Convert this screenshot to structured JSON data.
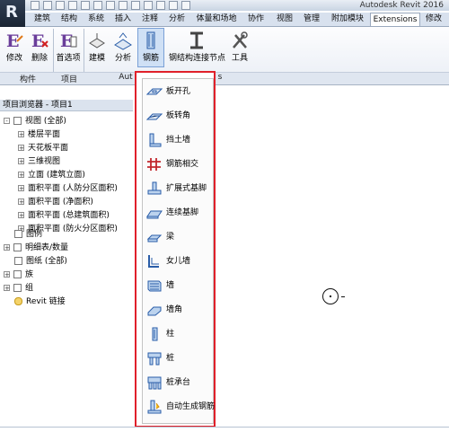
{
  "app": {
    "title": "Autodesk Revit 2016"
  },
  "tabs": [
    {
      "label": "建筑",
      "active": false
    },
    {
      "label": "结构",
      "active": false
    },
    {
      "label": "系统",
      "active": false
    },
    {
      "label": "插入",
      "active": false
    },
    {
      "label": "注释",
      "active": false
    },
    {
      "label": "分析",
      "active": false
    },
    {
      "label": "体量和场地",
      "active": false
    },
    {
      "label": "协作",
      "active": false
    },
    {
      "label": "视图",
      "active": false
    },
    {
      "label": "管理",
      "active": false
    },
    {
      "label": "附加模块",
      "active": false
    },
    {
      "label": "Extensions",
      "active": true
    },
    {
      "label": "修改",
      "active": false
    }
  ],
  "ribbon": {
    "buttons": {
      "modify": "修改",
      "delete": "删除",
      "preferences": "首选项",
      "model": "建模",
      "analysis": "分析",
      "rebar": "钢筋",
      "steel_connect": "钢结构连接节点",
      "tools": "工具"
    },
    "panels": {
      "component": "构件",
      "project": "项目",
      "auto_partial": "Aut",
      "tail": "s"
    }
  },
  "browser": {
    "title": "项目浏览器 - 项目1",
    "items": [
      {
        "label": "视图 (全部)",
        "level": 0,
        "toggle": "-"
      },
      {
        "label": "楼层平面",
        "level": 1,
        "toggle": "+"
      },
      {
        "label": "天花板平面",
        "level": 1,
        "toggle": "+"
      },
      {
        "label": "三维视图",
        "level": 1,
        "toggle": "+"
      },
      {
        "label": "立面 (建筑立面)",
        "level": 1,
        "toggle": "+"
      },
      {
        "label": "面积平面 (人防分区面积)",
        "level": 1,
        "toggle": "+"
      },
      {
        "label": "面积平面 (净面积)",
        "level": 1,
        "toggle": "+"
      },
      {
        "label": "面积平面 (总建筑面积)",
        "level": 1,
        "toggle": "+"
      },
      {
        "label": "面积平面 (防火分区面积)",
        "level": 1,
        "toggle": "+"
      },
      {
        "label": "图例",
        "level": 0,
        "toggle": ""
      },
      {
        "label": "明细表/数量",
        "level": 0,
        "toggle": "+"
      },
      {
        "label": "图纸 (全部)",
        "level": 0,
        "toggle": ""
      },
      {
        "label": "族",
        "level": 0,
        "toggle": "+"
      },
      {
        "label": "组",
        "level": 0,
        "toggle": "+"
      },
      {
        "label": "Revit 链接",
        "level": 0,
        "toggle": ""
      }
    ]
  },
  "rebar_menu": {
    "items": [
      {
        "label": "板开孔",
        "icon": "slab-opening-icon"
      },
      {
        "label": "板转角",
        "icon": "slab-corner-icon"
      },
      {
        "label": "挡土墙",
        "icon": "retaining-wall-icon"
      },
      {
        "label": "钢筋相交",
        "icon": "rebar-intersection-icon"
      },
      {
        "label": "扩展式基脚",
        "icon": "spread-footing-icon"
      },
      {
        "label": "连续基脚",
        "icon": "continuous-footing-icon"
      },
      {
        "label": "梁",
        "icon": "beam-icon"
      },
      {
        "label": "女儿墙",
        "icon": "parapet-icon"
      },
      {
        "label": "墙",
        "icon": "wall-icon"
      },
      {
        "label": "墙角",
        "icon": "wall-corner-icon"
      },
      {
        "label": "柱",
        "icon": "column-icon"
      },
      {
        "label": "桩",
        "icon": "pile-icon"
      },
      {
        "label": "桩承台",
        "icon": "pile-cap-icon"
      },
      {
        "label": "自动生成钢筋",
        "icon": "auto-rebar-icon"
      }
    ]
  },
  "colors": {
    "highlight": "#e0202a",
    "accent": "#6a3d9a"
  }
}
